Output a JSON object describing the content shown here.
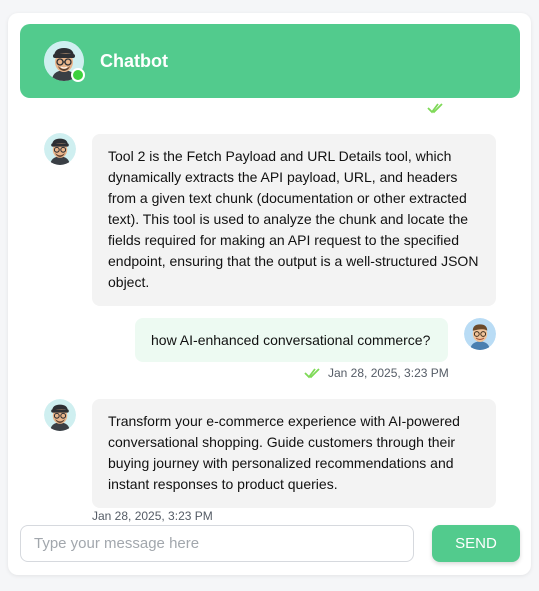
{
  "colors": {
    "accent": "#52cb8d",
    "check": "#7ed957"
  },
  "header": {
    "title": "Chatbot",
    "avatar_icon": "bot-avatar-icon",
    "status": "online"
  },
  "messages": [
    {
      "sender": "bot",
      "text": "Tool 2 is the Fetch Payload and URL Details tool, which dynamically extracts the API payload, URL, and headers from a given text chunk (documentation or other extracted text). This tool is used to analyze the chunk and locate the fields required for making an API request to the specified endpoint, ensuring that the output is a well-structured JSON object."
    },
    {
      "sender": "user",
      "text": "how AI-enhanced conversational commerce?",
      "timestamp": "Jan 28, 2025, 3:23 PM",
      "read": true
    },
    {
      "sender": "bot",
      "text": "Transform your e-commerce experience with AI-powered conversational shopping. Guide customers through their buying journey with personalized recommendations and instant responses to product queries.",
      "timestamp": "Jan 28, 2025, 3:23 PM"
    }
  ],
  "composer": {
    "placeholder": "Type your message here",
    "send_label": "SEND"
  }
}
